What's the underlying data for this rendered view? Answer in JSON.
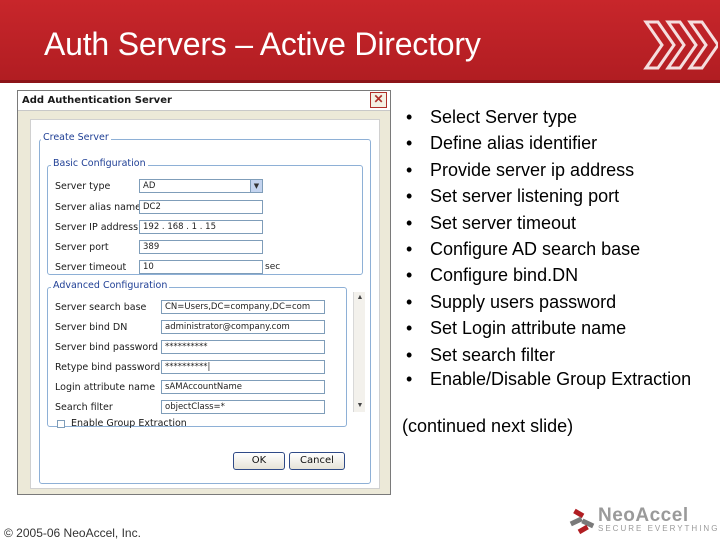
{
  "slide": {
    "title": "Auth Servers – Active Directory",
    "continued": "(continued next slide)",
    "copyright": "© 2005-06 NeoAccel, Inc.",
    "logo_name": "NeoAccel",
    "logo_tagline": "SECURE EVERYTHING"
  },
  "bullets": [
    "Select Server type",
    "Define alias identifier",
    "Provide server ip address",
    "Set server listening port",
    "Set server timeout",
    "Configure AD search base",
    "Configure bind.DN",
    "Supply users password",
    "Set Login attribute name",
    "Set search filter",
    "Enable/Disable Group Extraction"
  ],
  "bullet_symbol": "•",
  "dialog": {
    "title": "Add Authentication Server",
    "close": "✕",
    "section_create": "Create Server",
    "section_basic": "Basic Configuration",
    "section_advanced": "Advanced Configuration",
    "basic": [
      {
        "label": "Server type",
        "value": "AD"
      },
      {
        "label": "Server alias name",
        "value": "DC2"
      },
      {
        "label": "Server IP address",
        "value": "192 . 168 . 1 . 15"
      },
      {
        "label": "Server port",
        "value": "389"
      },
      {
        "label": "Server timeout",
        "value": "10",
        "unit": "sec"
      }
    ],
    "advanced": [
      {
        "label": "Server search base",
        "value": "CN=Users,DC=company,DC=com"
      },
      {
        "label": "Server bind DN",
        "value": "administrator@company.com"
      },
      {
        "label": "Server bind password",
        "value": "**********"
      },
      {
        "label": "Retype bind password",
        "value": "**********|"
      },
      {
        "label": "Login attribute name",
        "value": "sAMAccountName"
      },
      {
        "label": "Search filter",
        "value": "objectClass=*"
      }
    ],
    "group_extraction": "Enable Group Extraction",
    "ok": "OK",
    "cancel": "Cancel"
  },
  "colors": {
    "header_red": "#c8262b",
    "accent_blue": "#1f3f95"
  }
}
